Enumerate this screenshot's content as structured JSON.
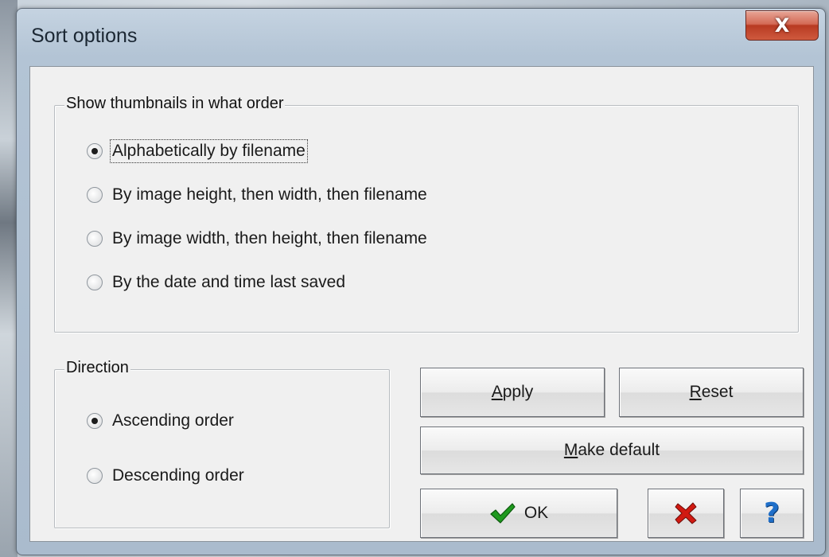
{
  "window": {
    "title": "Sort options",
    "close_glyph": "X"
  },
  "order_group": {
    "label": "Show thumbnails in what order",
    "options": [
      {
        "label": "Alphabetically by filename",
        "checked": true
      },
      {
        "label": "By image height, then width, then filename",
        "checked": false
      },
      {
        "label": "By image width, then height, then filename",
        "checked": false
      },
      {
        "label": "By the date and time last saved",
        "checked": false
      }
    ]
  },
  "direction_group": {
    "label": "Direction",
    "options": [
      {
        "label": "Ascending order",
        "checked": true
      },
      {
        "label": "Descending order",
        "checked": false
      }
    ]
  },
  "buttons": {
    "apply": {
      "accel": "A",
      "rest": "pply"
    },
    "reset": {
      "accel": "R",
      "rest": "eset"
    },
    "make_default": {
      "accel": "M",
      "rest": "ake default"
    },
    "ok": {
      "label": "OK",
      "icon": "checkmark-icon"
    },
    "cancel": {
      "icon": "red-x-icon"
    },
    "help": {
      "icon": "question-mark-icon",
      "glyph": "?"
    }
  },
  "colors": {
    "ok_check": "#1f9a1f",
    "cancel_x": "#d11a12",
    "help_q": "#1f6fc9"
  }
}
